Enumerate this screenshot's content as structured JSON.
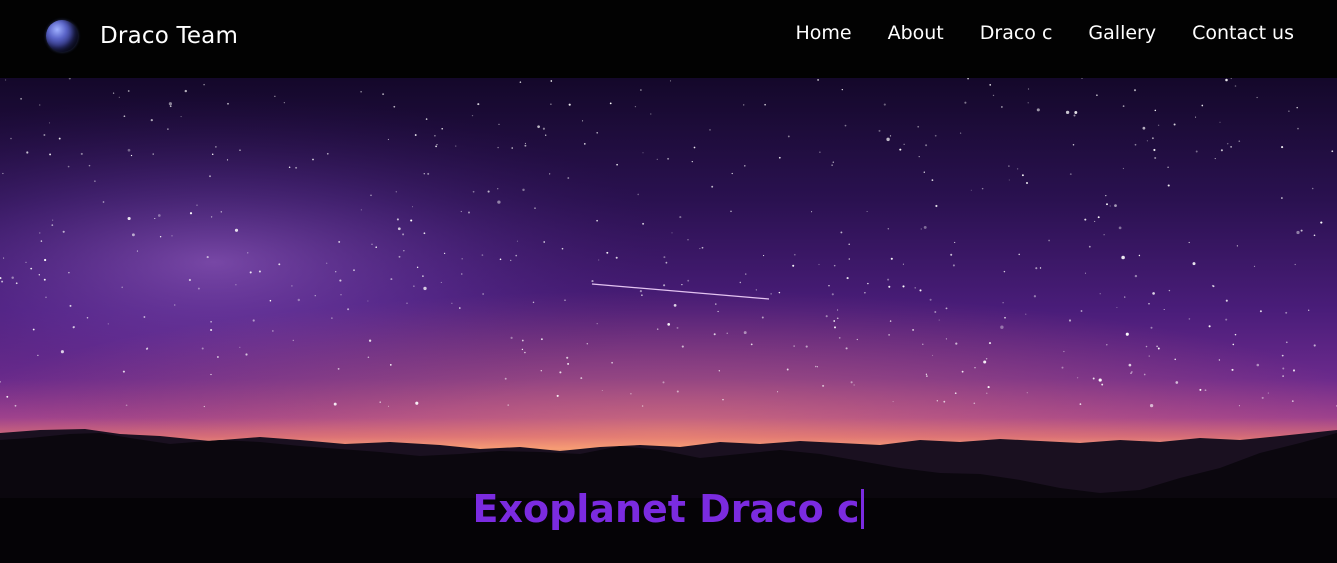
{
  "brand": {
    "name": "Draco Team",
    "logo_icon": "planet-icon"
  },
  "nav": {
    "items": [
      {
        "label": "Home"
      },
      {
        "label": "About"
      },
      {
        "label": "Draco c"
      },
      {
        "label": "Gallery"
      },
      {
        "label": "Contact us"
      }
    ]
  },
  "hero": {
    "title": "Exoplanet Draco c",
    "title_color": "#7b2be0",
    "background": "starry-night-sky-over-mountains"
  }
}
